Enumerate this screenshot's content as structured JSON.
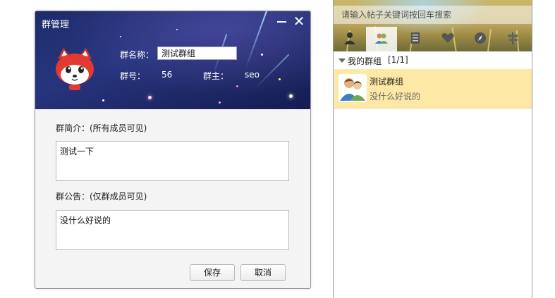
{
  "dialog": {
    "title": "群管理",
    "name_label": "群名称：",
    "name_value": "测试群组",
    "number_label": "群号：",
    "number_value": "56",
    "owner_label": "群主：",
    "owner_value": "seo",
    "intro_label": "群简介：(所有成员可见)",
    "intro_value": "测试一下",
    "notice_label": "群公告：(仅群成员可见)",
    "notice_value": "没什么好说的",
    "save_label": "保存",
    "cancel_label": "取消"
  },
  "right_panel": {
    "search_placeholder": "请输入帖子关键词按回车搜索",
    "tabs": [
      "person-icon",
      "group-icon",
      "notepad-icon",
      "heart-icon",
      "compass-icon",
      "signpost-icon"
    ],
    "group_section_label": "我的群组",
    "group_section_count": "[1/1]",
    "groups": [
      {
        "name": "测试群组",
        "description": "没什么好说的"
      }
    ]
  },
  "colors": {
    "header_bg": "#1e2b6a",
    "selected_item_bg": "#fde8a6"
  }
}
